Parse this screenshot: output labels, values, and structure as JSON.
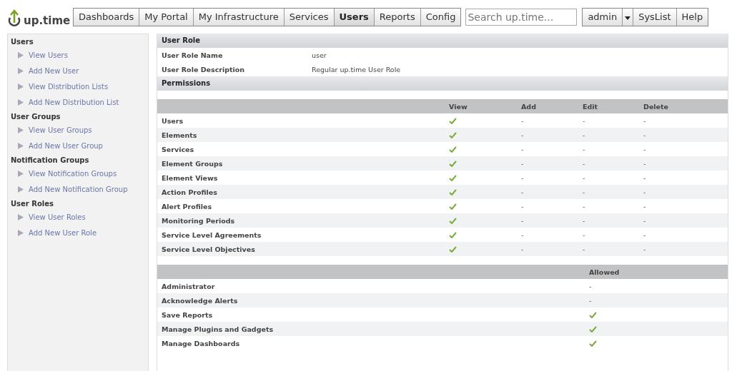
{
  "logo": {
    "text": "up.time"
  },
  "nav": [
    {
      "label": "Dashboards",
      "selected": false
    },
    {
      "label": "My Portal",
      "selected": false
    },
    {
      "label": "My Infrastructure",
      "selected": false
    },
    {
      "label": "Services",
      "selected": false
    },
    {
      "label": "Users",
      "selected": true
    },
    {
      "label": "Reports",
      "selected": false
    },
    {
      "label": "Config",
      "selected": false
    }
  ],
  "search": {
    "placeholder": "Search up.time..."
  },
  "user_menu": {
    "label": "admin"
  },
  "right_buttons": [
    "SysList",
    "Help"
  ],
  "sidebar": [
    {
      "heading": "Users",
      "items": [
        "View Users",
        "Add New User",
        "View Distribution Lists",
        "Add New Distribution List"
      ]
    },
    {
      "heading": "User Groups",
      "items": [
        "View User Groups",
        "Add New User Group"
      ]
    },
    {
      "heading": "Notification Groups",
      "items": [
        "View Notification Groups",
        "Add New Notification Group"
      ]
    },
    {
      "heading": "User Roles",
      "items": [
        "View User Roles",
        "Add New User Role"
      ]
    }
  ],
  "user_role": {
    "title": "User Role",
    "fields": [
      {
        "label": "User Role Name",
        "value": "user"
      },
      {
        "label": "User Role Description",
        "value": "Regular up.time User Role"
      }
    ]
  },
  "permissions": {
    "title": "Permissions",
    "columns": [
      "View",
      "Add",
      "Edit",
      "Delete"
    ],
    "rows": [
      {
        "name": "Users",
        "cells": [
          true,
          "-",
          "-",
          "-"
        ]
      },
      {
        "name": "Elements",
        "cells": [
          true,
          "-",
          "-",
          "-"
        ]
      },
      {
        "name": "Services",
        "cells": [
          true,
          "-",
          "-",
          "-"
        ]
      },
      {
        "name": "Element Groups",
        "cells": [
          true,
          "-",
          "-",
          "-"
        ]
      },
      {
        "name": "Element Views",
        "cells": [
          true,
          "-",
          "-",
          "-"
        ]
      },
      {
        "name": "Action Profiles",
        "cells": [
          true,
          "-",
          "-",
          "-"
        ]
      },
      {
        "name": "Alert Profiles",
        "cells": [
          true,
          "-",
          "-",
          "-"
        ]
      },
      {
        "name": "Monitoring Periods",
        "cells": [
          true,
          "-",
          "-",
          "-"
        ]
      },
      {
        "name": "Service Level Agreements",
        "cells": [
          true,
          "-",
          "-",
          "-"
        ]
      },
      {
        "name": "Service Level Objectives",
        "cells": [
          true,
          "-",
          "-",
          "-"
        ]
      }
    ]
  },
  "privileges": {
    "column": "Allowed",
    "rows": [
      {
        "name": "Administrator",
        "allowed": "-"
      },
      {
        "name": "Acknowledge Alerts",
        "allowed": "-"
      },
      {
        "name": "Save Reports",
        "allowed": true
      },
      {
        "name": "Manage Plugins and Gadgets",
        "allowed": true
      },
      {
        "name": "Manage Dashboards",
        "allowed": true
      }
    ]
  }
}
